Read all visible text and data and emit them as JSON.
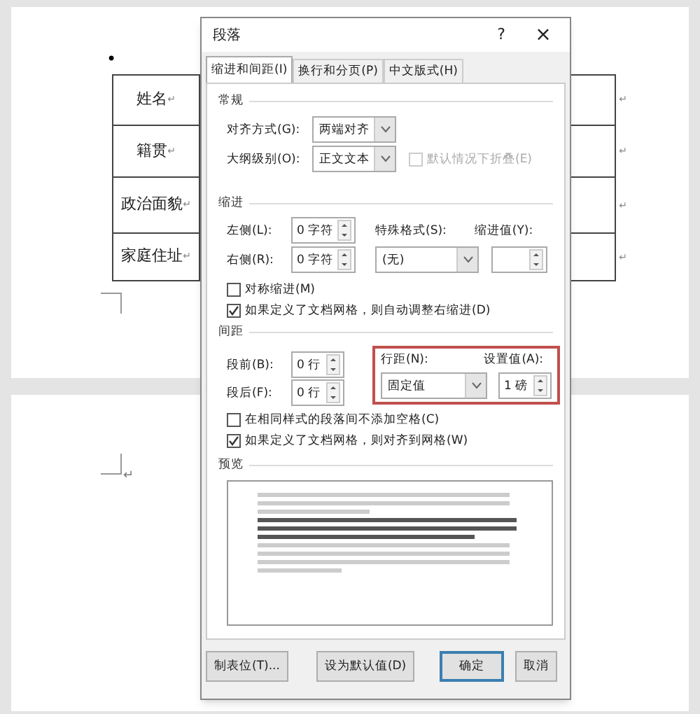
{
  "document": {
    "bullet": "•",
    "rows": [
      {
        "label": "姓名",
        "mark": "↵",
        "end_mark": "↵"
      },
      {
        "label": "籍贯",
        "mark": "↵",
        "end_mark": "↵"
      },
      {
        "label": "政治面貌",
        "mark": "↵",
        "end_mark": "↵"
      },
      {
        "label": "家庭住址",
        "mark": "↵",
        "end_mark": "↵"
      }
    ],
    "page2_mark": "↵"
  },
  "dialog": {
    "title": "段落",
    "help": "?",
    "close": "×",
    "tabs": [
      {
        "label": "缩进和间距(I)",
        "selected": true
      },
      {
        "label": "换行和分页(P)",
        "selected": false
      },
      {
        "label": "中文版式(H)",
        "selected": false
      }
    ],
    "general": {
      "heading": "常规",
      "alignment": {
        "label": "对齐方式(G):",
        "value": "两端对齐"
      },
      "outline_level": {
        "label": "大纲级别(O):",
        "value": "正文文本"
      },
      "collapse": {
        "label": "默认情况下折叠(E)",
        "checked": false,
        "disabled": true
      }
    },
    "indent": {
      "heading": "缩进",
      "left": {
        "label": "左侧(L):",
        "value": "0 字符"
      },
      "right": {
        "label": "右侧(R):",
        "value": "0 字符"
      },
      "special": {
        "label": "特殊格式(S):",
        "value": "(无)"
      },
      "by": {
        "label": "缩进值(Y):"
      },
      "options": [
        {
          "label": "对称缩进(M)",
          "checked": false,
          "disabled": false
        },
        {
          "label": "如果定义了文档网格，则自动调整右缩进(D)",
          "checked": true,
          "disabled": false
        }
      ]
    },
    "spacing": {
      "heading": "间距",
      "before": {
        "label": "段前(B):",
        "value": "0 行"
      },
      "after": {
        "label": "段后(F):",
        "value": "0 行"
      },
      "line_spacing": {
        "label": "行距(N):",
        "value": "固定值"
      },
      "at": {
        "label": "设置值(A):",
        "value": "1 磅"
      },
      "options": [
        {
          "label": "在相同样式的段落间不添加空格(C)",
          "checked": false,
          "disabled": false
        },
        {
          "label": "如果定义了文档网格，则对齐到网格(W)",
          "checked": true,
          "disabled": false
        }
      ]
    },
    "preview": {
      "heading": "预览"
    },
    "buttons": [
      {
        "label": "制表位(T)...",
        "default": false
      },
      {
        "label": "设为默认值(D)",
        "default": false
      },
      {
        "label": "确定",
        "default": true
      },
      {
        "label": "取消",
        "default": false
      }
    ]
  }
}
